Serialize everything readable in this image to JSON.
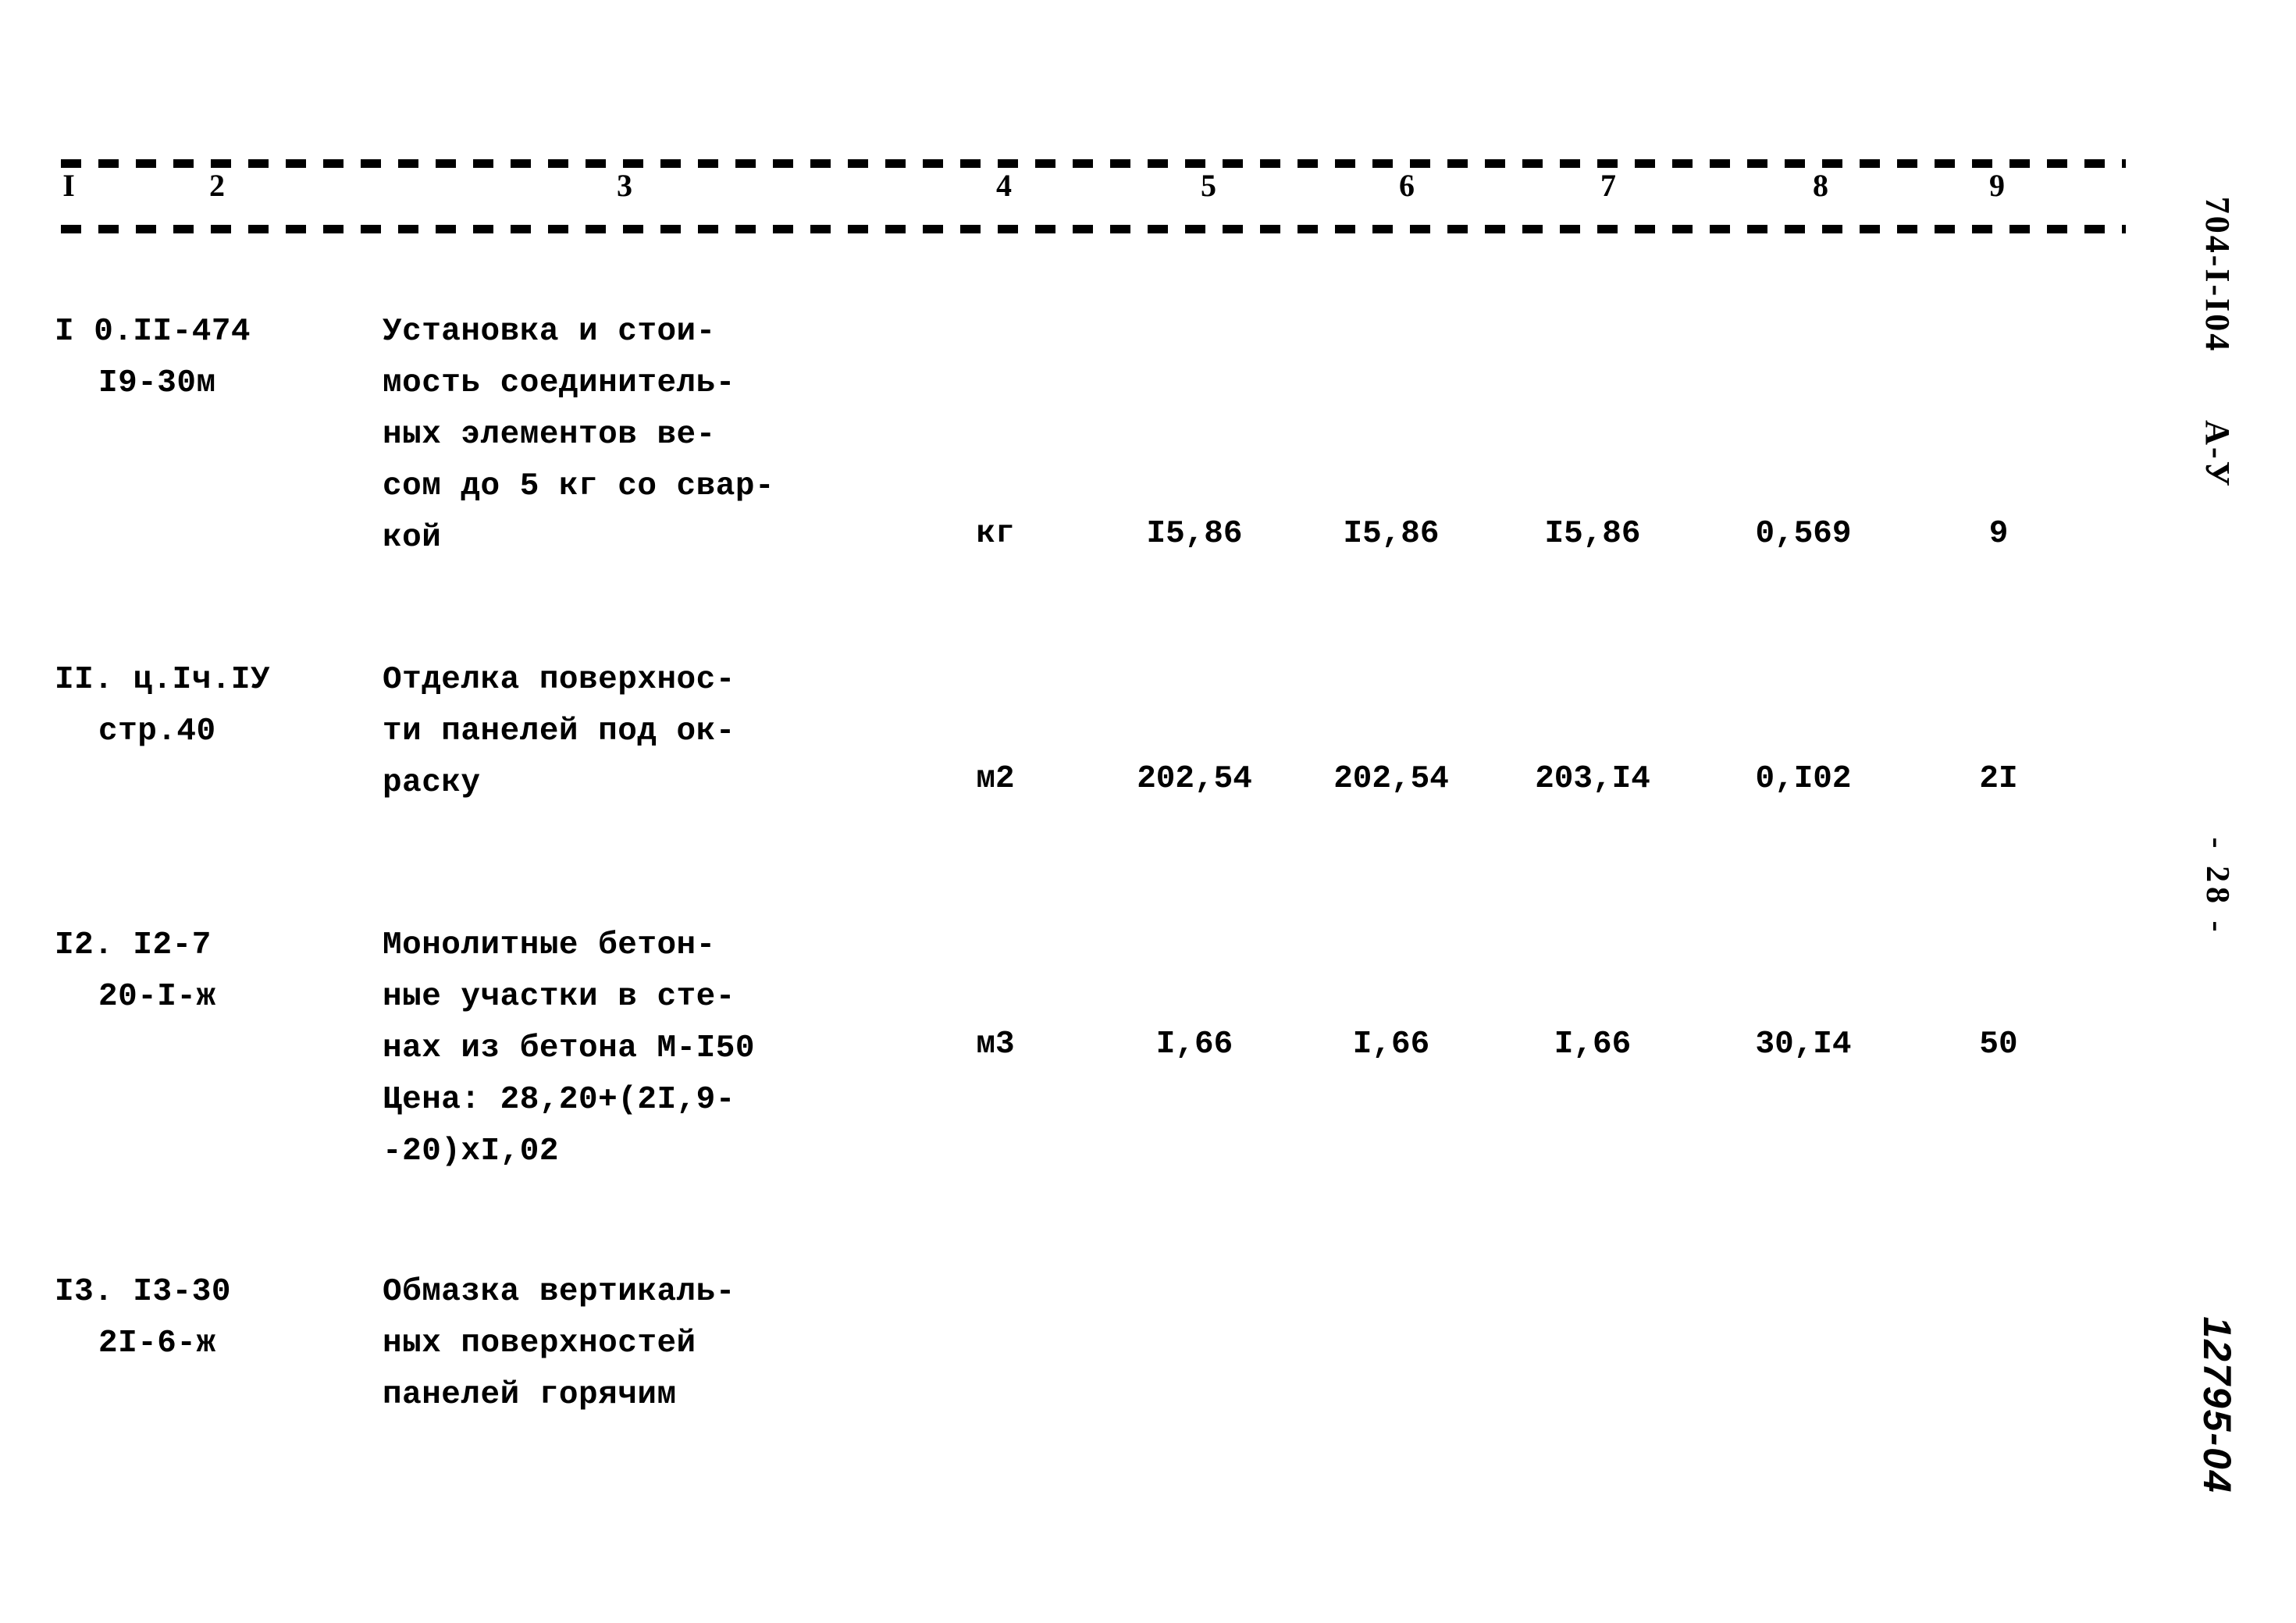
{
  "document": {
    "right_margin": {
      "doc_code": "704-I-I04",
      "doc_sub": "А-У",
      "page_marker": "- 28 -",
      "stamp": "12795-04"
    }
  },
  "table": {
    "column_numbers": [
      "I",
      "2",
      "3",
      "4",
      "5",
      "6",
      "7",
      "8",
      "9"
    ],
    "rows": [
      {
        "code_line1": "I 0.II-474",
        "code_line2": "I9-30м",
        "description": [
          "Установка и стои-",
          "мость соединитель-",
          "ных элементов ве-",
          "сом до 5 кг со свар-",
          "кой"
        ],
        "unit": "кг",
        "col5": "I5,86",
        "col6": "I5,86",
        "col7": "I5,86",
        "col8": "0,569",
        "col9": "9"
      },
      {
        "code_line1": "II. ц.Iч.IУ",
        "code_line2": "стр.40",
        "description": [
          "Отделка поверхнос-",
          "ти панелей под ок-",
          "раску"
        ],
        "unit": "м2",
        "col5": "202,54",
        "col6": "202,54",
        "col7": "203,I4",
        "col8": "0,I02",
        "col9": "2I"
      },
      {
        "code_line1": "I2. I2-7",
        "code_line2": "20-I-ж",
        "description": [
          "Монолитные бетон-",
          "ные участки в сте-",
          "нах из бетона М-I50",
          "Цена: 28,20+(2I,9-",
          "-20)хI,02"
        ],
        "unit": "м3",
        "col5": "I,66",
        "col6": "I,66",
        "col7": "I,66",
        "col8": "30,I4",
        "col9": "50"
      },
      {
        "code_line1": "I3. I3-30",
        "code_line2": "2I-6-ж",
        "description": [
          "Обмазка вертикаль-",
          "ных поверхностей",
          "панелей горячим"
        ],
        "unit": "",
        "col5": "",
        "col6": "",
        "col7": "",
        "col8": "",
        "col9": ""
      }
    ]
  }
}
